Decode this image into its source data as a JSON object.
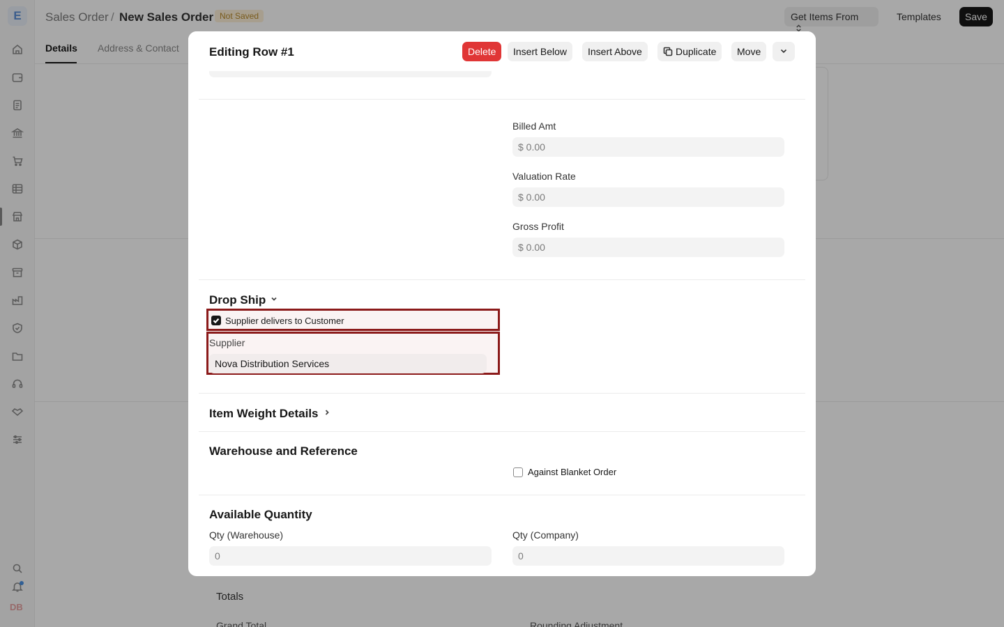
{
  "app": {
    "logo_letter": "E",
    "avatar_initials": "DB"
  },
  "sidebar": {
    "icons": [
      "home-icon",
      "wallet-icon",
      "document-icon",
      "bank-icon",
      "cart-icon",
      "table-icon",
      "store-icon",
      "box-icon",
      "archive-icon",
      "factory-icon",
      "shield-icon",
      "folder-icon",
      "headset-icon",
      "handshake-icon",
      "sliders-icon"
    ],
    "bottom_icons": [
      "search-icon",
      "bell-icon"
    ]
  },
  "topbar": {
    "breadcrumb_parent": "Sales Order",
    "breadcrumb_sep": "/",
    "breadcrumb_current": "New Sales Order",
    "status_badge": "Not Saved",
    "get_items_label": "Get Items From",
    "templates_label": "Templates",
    "save_label": "Save"
  },
  "tabs": [
    {
      "label": "Details",
      "active": true
    },
    {
      "label": "Address & Contact",
      "active": false
    }
  ],
  "background": {
    "totals_label": "Totals",
    "grand_total_label": "Grand Total",
    "rounding_label": "Rounding Adjustment"
  },
  "modal": {
    "title": "Editing Row #1",
    "buttons": {
      "delete": "Delete",
      "insert_below": "Insert Below",
      "insert_above": "Insert Above",
      "duplicate": "Duplicate",
      "move": "Move"
    },
    "fields": {
      "billed_amt_label": "Billed Amt",
      "billed_amt_value": "$ 0.00",
      "valuation_rate_label": "Valuation Rate",
      "valuation_rate_value": "$ 0.00",
      "gross_profit_label": "Gross Profit",
      "gross_profit_value": "$ 0.00"
    },
    "drop_ship": {
      "title": "Drop Ship",
      "checkbox_label": "Supplier delivers to Customer",
      "checkbox_checked": true,
      "supplier_label": "Supplier",
      "supplier_value": "Nova Distribution Services"
    },
    "item_weight_title": "Item Weight Details",
    "warehouse": {
      "title": "Warehouse and Reference",
      "blanket_order_label": "Against Blanket Order",
      "blanket_order_checked": false
    },
    "available_qty": {
      "title": "Available Quantity",
      "qty_warehouse_label": "Qty (Warehouse)",
      "qty_warehouse_value": "0",
      "qty_company_label": "Qty (Company)",
      "qty_company_value": "0"
    }
  },
  "colors": {
    "danger": "#e03636",
    "highlight_border": "#8b1a1a",
    "highlight_fill": "#faf3f3",
    "input_bg": "#f3f3f3"
  }
}
